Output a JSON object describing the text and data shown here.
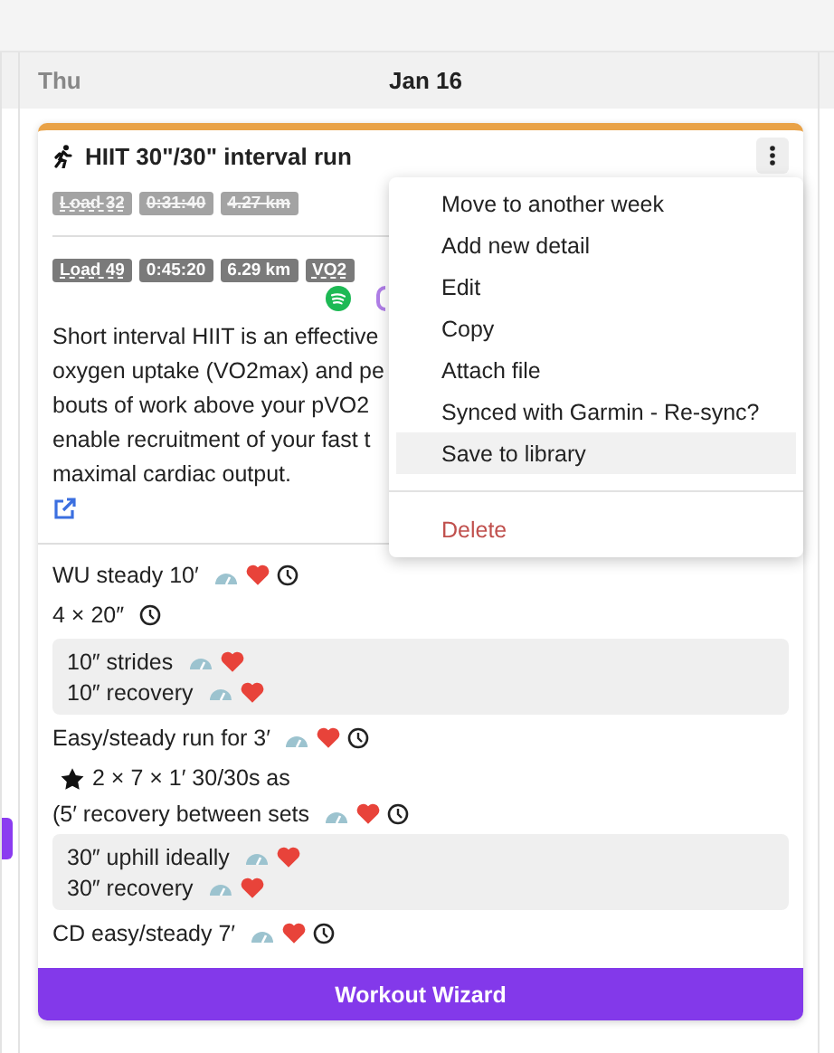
{
  "header": {
    "weekday": "Thu",
    "date": "Jan 16"
  },
  "workout": {
    "title": "HIIT 30\"/30\" interval run",
    "planned_badges": [
      {
        "text": "Load 32",
        "struck": true,
        "underlined": true
      },
      {
        "text": "0:31:40",
        "struck": true,
        "underlined": false
      },
      {
        "text": "4.27 km",
        "struck": true,
        "underlined": false
      }
    ],
    "actual_badges": [
      {
        "text": "Load 49",
        "struck": false,
        "underlined": true
      },
      {
        "text": "0:45:20",
        "struck": false,
        "underlined": false
      },
      {
        "text": "6.29 km",
        "struck": false,
        "underlined": false
      },
      {
        "text": "VO2",
        "struck": false,
        "underlined": true
      }
    ],
    "description_lines": [
      "Short interval HIIT is an effective",
      "oxygen uptake (VO2max) and pe",
      "bouts of work above your pVO2",
      "enable recruitment of your fast t",
      "maximal cardiac output."
    ],
    "steps": [
      {
        "kind": "step",
        "text": "WU steady 10′",
        "gauge": true,
        "heart": true,
        "clock": true
      },
      {
        "kind": "step",
        "text": "4 × 20″",
        "gauge": false,
        "heart": false,
        "clock": true
      },
      {
        "kind": "group",
        "children": [
          {
            "text": "10″ strides",
            "gauge": true,
            "heart": true,
            "clock": false
          },
          {
            "text": "10″ recovery",
            "gauge": true,
            "heart": true,
            "clock": false
          }
        ]
      },
      {
        "kind": "step",
        "text": "Easy/steady run for 3′",
        "gauge": true,
        "heart": true,
        "clock": true
      },
      {
        "kind": "starred",
        "text": "2 × 7 × 1′ 30/30s as"
      },
      {
        "kind": "step",
        "text": "(5′ recovery between sets",
        "gauge": true,
        "heart": true,
        "clock": true
      },
      {
        "kind": "group",
        "children": [
          {
            "text": "30″ uphill ideally",
            "gauge": true,
            "heart": true,
            "clock": false
          },
          {
            "text": "30″ recovery",
            "gauge": true,
            "heart": true,
            "clock": false
          }
        ]
      },
      {
        "kind": "step",
        "text": "CD easy/steady 7′",
        "gauge": true,
        "heart": true,
        "clock": true
      }
    ],
    "button": "Workout Wizard"
  },
  "menu": [
    {
      "label": "Move to another week",
      "selected": false,
      "kind": "item"
    },
    {
      "label": "Add new detail",
      "selected": false,
      "kind": "item"
    },
    {
      "label": "Edit",
      "selected": false,
      "kind": "item"
    },
    {
      "label": "Copy",
      "selected": false,
      "kind": "item"
    },
    {
      "label": "Attach file",
      "selected": false,
      "kind": "item"
    },
    {
      "label": "Synced with Garmin - Re-sync?",
      "selected": false,
      "kind": "item"
    },
    {
      "label": "Save to library",
      "selected": true,
      "kind": "item"
    },
    {
      "label": "Delete",
      "selected": false,
      "kind": "danger"
    }
  ]
}
